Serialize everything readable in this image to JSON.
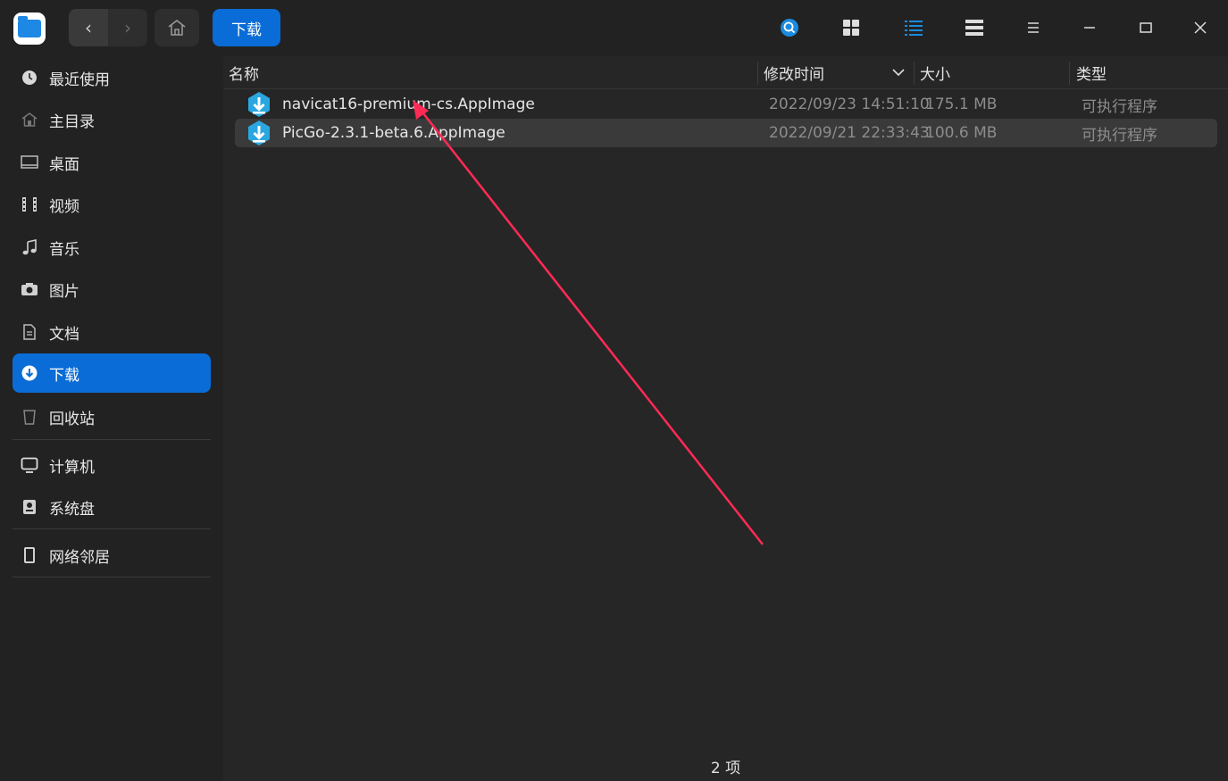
{
  "titlebar": {
    "breadcrumb": "下载",
    "icons": [
      "back-icon",
      "forward-icon",
      "home-icon",
      "search-icon",
      "grid-view-icon",
      "list-view-icon",
      "tree-view-icon",
      "menu-icon",
      "minimize-icon",
      "maximize-icon",
      "close-icon"
    ]
  },
  "sidebar": {
    "items": [
      {
        "label": "最近使用",
        "icon": "clock-icon"
      },
      {
        "label": "主目录",
        "icon": "home-icon"
      },
      {
        "label": "桌面",
        "icon": "desktop-icon"
      },
      {
        "label": "视频",
        "icon": "film-icon"
      },
      {
        "label": "音乐",
        "icon": "music-icon"
      },
      {
        "label": "图片",
        "icon": "camera-icon"
      },
      {
        "label": "文档",
        "icon": "document-icon"
      },
      {
        "label": "下载",
        "icon": "download-icon"
      },
      {
        "label": "回收站",
        "icon": "trash-icon"
      },
      {
        "label": "计算机",
        "icon": "monitor-icon"
      },
      {
        "label": "系统盘",
        "icon": "disk-icon"
      },
      {
        "label": "网络邻居",
        "icon": "network-icon"
      }
    ],
    "active": "下载"
  },
  "table": {
    "headers": {
      "name": "名称",
      "modified": "修改时间",
      "size": "大小",
      "type": "类型"
    },
    "sort_indicator": "chevron-down-icon",
    "rows": [
      {
        "name": "navicat16-premium-cs.AppImage",
        "modified": "2022/09/23 14:51:10",
        "size": "175.1 MB",
        "type": "可执行程序"
      },
      {
        "name": "PicGo-2.3.1-beta.6.AppImage",
        "modified": "2022/09/21 22:33:43",
        "size": "100.6 MB",
        "type": "可执行程序"
      }
    ]
  },
  "status": {
    "count": "2 项"
  },
  "colors": {
    "accent": "#0a6cd6",
    "annotation_arrow": "#ff2a55",
    "file_icon": "#2aa7e0"
  }
}
